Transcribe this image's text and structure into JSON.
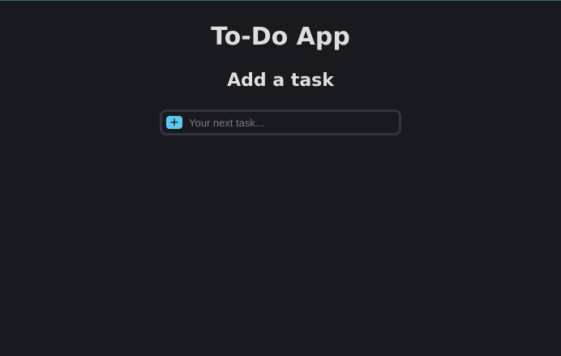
{
  "app": {
    "title": "To-Do App"
  },
  "add_task": {
    "heading": "Add a task",
    "button_label": "+",
    "input_placeholder": "Your next task...",
    "input_value": ""
  },
  "colors": {
    "background": "#191920",
    "accent": "#5ec8f0",
    "input_border": "#34343c",
    "text": "#dedee0"
  },
  "icons": {
    "add": "plus-icon"
  }
}
